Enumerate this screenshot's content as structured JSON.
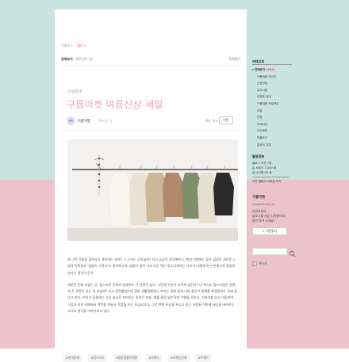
{
  "colors": {
    "accent": "#e54b8a",
    "title": "#e7a1bf",
    "bg_top": "#c9e4df",
    "bg_bottom": "#ecc3cc"
  },
  "breadcrumb": {
    "home": "구름로그",
    "current": "블로그"
  },
  "list": {
    "all_label": "전체보기",
    "count": "(485개의 글)",
    "toggle": "목록열기"
  },
  "post": {
    "category": "신상안내",
    "title": "구름마켓 여름신상 세일",
    "author": "구름마켓",
    "time": "18시간 전",
    "url_label": "URL 복사",
    "follow_label": "이웃",
    "more_icon": "more-vertical-icon",
    "paragraphs": [
      "왜 그런 것들을 힙하다고 생각하는 걸까? 그 근거는 무엇일까? 라고 궁금히 생각해보니, 뻔지 이젠에는 불수 없었던 새로운 느낌의 독특함과 '날들이 그렇다'고 생각하니까, 남들이 잘어 가서 사진 찍는 장소니까라는 사고가 다채게 아닌 분위기가 형성되었다는 생각이 든다.",
      "새로운 문화 조류는 곧, 힙스러운 문화와 탐생과도 큰 연관이 있다. 그런데 우연가 다르지 않은가? 나 역시도 힙스러움은 유행과 큰 관련이 있는 게 아닐까? 라고 생각했었는데 힙한 생활학했었나 저자는 생형 앞게 너와 좋은이 관계를 제정합하는 것에 있다고 한다. 우리가 집중하는 것은 끌고로 보여지는 외적인 부분, 예를 들면 엽수학한 수행을 가르고, 거쳐가를 타고 이동하며 스탑과 따로 카페에서 맥북을 켜놓고 작업을 하는 모습보다고, 그런 뻔한 모습을 지니고 있는 사람들 이면에 세상을 바라보는 시각과 생각을 이야기하고 있다."
    ],
    "tags": [
      "#한국문화",
      "#힙스터즈",
      "#힙한생활학개론",
      "#브랜드",
      "#브랜딩문화",
      "#트렌드"
    ]
  },
  "sidebar": {
    "category_title": "카테고리",
    "categories": [
      {
        "label": "전체보기",
        "count": "(485)",
        "level": "main"
      },
      {
        "label": "구름마켓 이야기",
        "count": "",
        "level": "sub"
      },
      {
        "label": "신상안내",
        "count": "",
        "level": "sub"
      },
      {
        "label": "공지사항",
        "count": "",
        "level": "sub"
      },
      {
        "label": "이벤트 안내",
        "count": "",
        "level": "sub"
      },
      {
        "label": "구름마켓 프로젝트",
        "count": "",
        "level": "sub"
      },
      {
        "label": "리뷰",
        "count": "",
        "level": "sub"
      },
      {
        "label": "인형",
        "count": "",
        "level": "sub"
      },
      {
        "label": "액세서리",
        "count": "",
        "level": "sub"
      },
      {
        "label": "코스메틱",
        "count": "",
        "level": "sub"
      },
      {
        "label": "미용도구",
        "count": "",
        "level": "sub"
      },
      {
        "label": "일상의 기록",
        "count": "",
        "level": "sub"
      }
    ],
    "stats_title": "활동정보",
    "stats": [
      "블로그 이웃 7명",
      "글 보내기 1,000 회",
      "글 스크랩 90 회",
      "",
      "이웃 활동이 어려운 보기"
    ],
    "profile": {
      "name": "구름마켓",
      "id": "(kogamlove_kr)",
      "text": [
        "안녕하세요,",
        "블로그를 처음 시작했어요!",
        "많이 찾아 오세요!"
      ],
      "neighbor_button": "+ 이웃추가"
    },
    "search_placeholder": "",
    "search_icon": "search-icon",
    "admin_label": "관리자"
  },
  "photo_icon": "clothes-rack-photo"
}
